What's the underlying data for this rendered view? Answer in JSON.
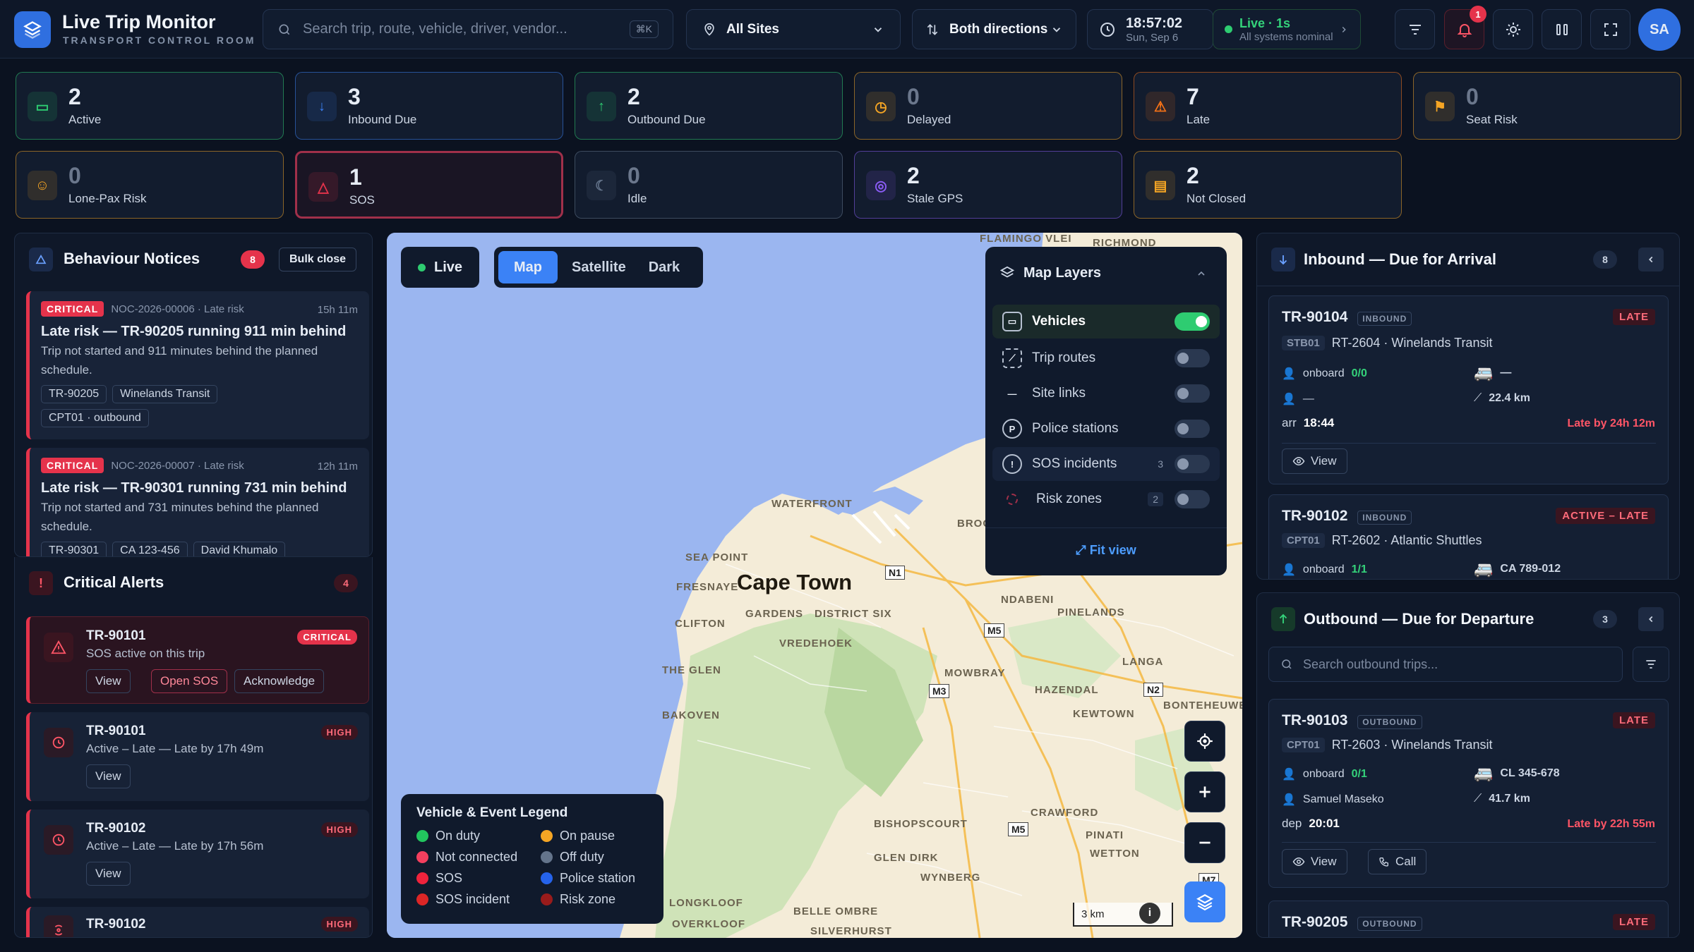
{
  "header": {
    "title": "Live Trip Monitor",
    "subtitle": "TRANSPORT CONTROL ROOM",
    "search_placeholder": "Search trip, route, vehicle, driver, vendor...",
    "search_shortcut": "⌘K",
    "sites_value": "All Sites",
    "direction_value": "Both directions",
    "time": "18:57:02",
    "date": "Sun, Sep 6",
    "live_label": "Live · 1s",
    "live_status": "All systems nominal",
    "notification_count": "1",
    "avatar_initials": "SA"
  },
  "kpis": [
    {
      "value": "2",
      "label": "Active",
      "color": "#2ecc71"
    },
    {
      "value": "3",
      "label": "Inbound Due",
      "color": "#3b82f6"
    },
    {
      "value": "2",
      "label": "Outbound Due",
      "color": "#2ecc71"
    },
    {
      "value": "0",
      "label": "Delayed",
      "color": "#f5a524"
    },
    {
      "value": "7",
      "label": "Late",
      "color": "#f97316"
    },
    {
      "value": "0",
      "label": "Seat Risk",
      "color": "#f5a524"
    },
    {
      "value": "0",
      "label": "Lone-Pax Risk",
      "color": "#f5a524"
    },
    {
      "value": "1",
      "label": "SOS",
      "color": "#e5334b"
    },
    {
      "value": "0",
      "label": "Idle",
      "color": "#64748b"
    },
    {
      "value": "2",
      "label": "Stale GPS",
      "color": "#8b5cf6"
    },
    {
      "value": "2",
      "label": "Not Closed",
      "color": "#f5a524"
    }
  ],
  "notices": {
    "title": "Behaviour Notices",
    "count": "8",
    "bulk_label": "Bulk close",
    "items": [
      {
        "tag": "CRITICAL",
        "meta": "NOC-2026-00006 · Late risk",
        "age": "15h 11m",
        "title": "Late risk — TR-90205 running 911 min behind",
        "desc": "Trip not started and 911 minutes behind the planned schedule.",
        "chips": [
          "TR-90205",
          "Winelands Transit",
          "CPT01 · outbound"
        ]
      },
      {
        "tag": "CRITICAL",
        "meta": "NOC-2026-00007 · Late risk",
        "age": "12h 11m",
        "title": "Late risk — TR-90301 running 731 min behind",
        "desc": "Trip not started and 731 minutes behind the planned schedule.",
        "chips": [
          "TR-90301",
          "CA 123-456",
          "David Khumalo"
        ]
      }
    ]
  },
  "alerts": {
    "title": "Critical Alerts",
    "count": "4",
    "items": [
      {
        "id": "TR-90101",
        "sub": "SOS active on this trip",
        "level": "CRITICAL",
        "btn1": "View",
        "btn2": "Open SOS",
        "btn3": "Acknowledge"
      },
      {
        "id": "TR-90101",
        "sub": "Active – Late — Late by 17h 49m",
        "level": "HIGH",
        "btn1": "View"
      },
      {
        "id": "TR-90102",
        "sub": "Active – Late — Late by 17h 56m",
        "level": "HIGH",
        "btn1": "View"
      },
      {
        "id": "TR-90102",
        "sub": "",
        "level": "HIGH"
      }
    ]
  },
  "map": {
    "live_label": "Live",
    "modes": [
      "Map",
      "Satellite",
      "Dark"
    ],
    "city_label": "Cape Town",
    "scale": "3 km",
    "places": [
      "FLAMINGO VLEI",
      "RICHMOND",
      "WATERFRONT",
      "SEA POINT",
      "FRESNAYE",
      "GARDENS",
      "DISTRICT SIX",
      "CLIFTON",
      "VREDEHOEK",
      "NDABENI",
      "PINELANDS",
      "MOWBRAY",
      "LANGA",
      "THE GLEN",
      "HAZENDAL",
      "BONTEHEUWEL",
      "KEWTOWN",
      "BAKOVEN",
      "CRAWFORD",
      "BISHOPSCOURT",
      "PINATI",
      "GLEN DIRK",
      "WYNBERG",
      "WETTON",
      "LONGKLOOF",
      "OVERKLOOF",
      "BELLE OMBRE",
      "SILVERHURST",
      "BROO"
    ],
    "roads": [
      "N1",
      "M5",
      "M3",
      "N2",
      "M5",
      "M7"
    ],
    "layers_title": "Map Layers",
    "layers": [
      {
        "name": "Vehicles",
        "on": true,
        "count": ""
      },
      {
        "name": "Trip routes",
        "on": false,
        "count": ""
      },
      {
        "name": "Site links",
        "on": false,
        "count": ""
      },
      {
        "name": "Police stations",
        "on": false,
        "count": ""
      },
      {
        "name": "SOS incidents",
        "on": false,
        "count": "3"
      },
      {
        "name": "Risk zones",
        "on": false,
        "count": "2"
      }
    ],
    "fit_view": "Fit view",
    "legend_title": "Vehicle & Event Legend",
    "legend": [
      {
        "label": "On duty",
        "color": "#22c55e"
      },
      {
        "label": "On pause",
        "color": "#f5a524"
      },
      {
        "label": "Not connected",
        "color": "#f43f5e"
      },
      {
        "label": "Off duty",
        "color": "#64748b"
      },
      {
        "label": "SOS",
        "color": "#ef233c"
      },
      {
        "label": "Police station",
        "color": "#2563eb"
      },
      {
        "label": "SOS incident",
        "color": "#dc2626"
      },
      {
        "label": "Risk zone",
        "color": "#991b1b"
      }
    ]
  },
  "inbound": {
    "title": "Inbound — Due for Arrival",
    "count": "8",
    "trips": [
      {
        "id": "TR-90104",
        "dir": "INBOUND",
        "site": "STB01",
        "route": "RT-2604 · Winelands Transit",
        "status": "LATE",
        "onboard_label": "onboard",
        "onboard": "0/0",
        "vehicle": "—",
        "driver": "—",
        "distance": "22.4 km",
        "time_label": "arr",
        "time": "18:44",
        "late": "Late by 24h 12m",
        "btn": "View"
      },
      {
        "id": "TR-90102",
        "dir": "INBOUND",
        "site": "CPT01",
        "route": "RT-2602 · Atlantic Shuttles",
        "status": "ACTIVE – LATE",
        "onboard_label": "onboard",
        "onboard": "1/1",
        "vehicle": "CA 789-012"
      }
    ]
  },
  "outbound": {
    "title": "Outbound — Due for Departure",
    "count": "3",
    "search_placeholder": "Search outbound trips...",
    "trips": [
      {
        "id": "TR-90103",
        "dir": "OUTBOUND",
        "site": "CPT01",
        "route": "RT-2603 · Winelands Transit",
        "status": "LATE",
        "onboard_label": "onboard",
        "onboard": "0/1",
        "vehicle": "CL 345-678",
        "driver": "Samuel Maseko",
        "distance": "41.7 km",
        "time_label": "dep",
        "time": "20:01",
        "late": "Late by 22h 55m",
        "btn": "View",
        "btn2": "Call"
      },
      {
        "id": "TR-90205",
        "dir": "OUTBOUND",
        "status": "LATE"
      }
    ]
  }
}
